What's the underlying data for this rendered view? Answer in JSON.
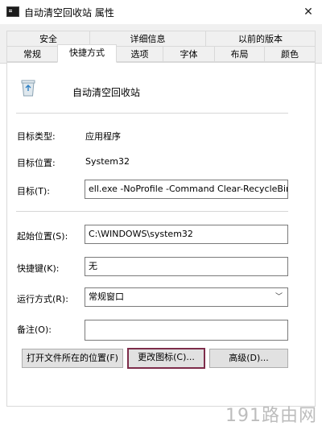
{
  "window": {
    "title": "自动清空回收站 属性",
    "close_glyph": "✕"
  },
  "tabs_row1": [
    "安全",
    "详细信息",
    "以前的版本"
  ],
  "tabs_row2": [
    "常规",
    "快捷方式",
    "选项",
    "字体",
    "布局",
    "颜色"
  ],
  "active_tab": "快捷方式",
  "shortcut": {
    "name": "自动清空回收站",
    "target_type_label": "目标类型:",
    "target_type_value": "应用程序",
    "target_location_label": "目标位置:",
    "target_location_value": "System32",
    "target_label": "目标(T):",
    "target_value": "ell.exe -NoProfile -Command Clear-RecycleBin\"",
    "start_in_label": "起始位置(S):",
    "start_in_value": "C:\\WINDOWS\\system32",
    "hotkey_label": "快捷键(K):",
    "hotkey_value": "无",
    "run_label": "运行方式(R):",
    "run_value": "常规窗口",
    "comment_label": "备注(O):",
    "comment_value": ""
  },
  "buttons": {
    "open_location": "打开文件所在的位置(F)",
    "change_icon": "更改图标(C)...",
    "advanced": "高级(D)..."
  },
  "watermark": "191路由网"
}
